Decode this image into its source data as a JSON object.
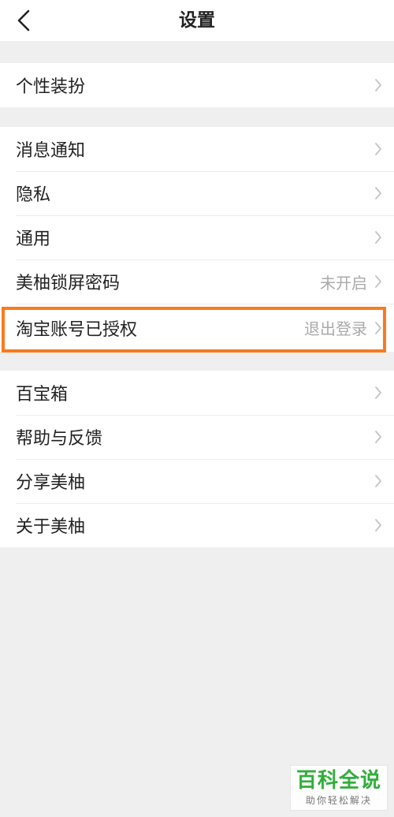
{
  "header": {
    "title": "设置"
  },
  "groups": [
    {
      "items": [
        {
          "label": "个性装扮",
          "value": ""
        }
      ]
    },
    {
      "items": [
        {
          "label": "消息通知",
          "value": ""
        },
        {
          "label": "隐私",
          "value": ""
        },
        {
          "label": "通用",
          "value": ""
        },
        {
          "label": "美柚锁屏密码",
          "value": "未开启"
        },
        {
          "label": "淘宝账号已授权",
          "value": "退出登录"
        }
      ]
    },
    {
      "items": [
        {
          "label": "百宝箱",
          "value": ""
        },
        {
          "label": "帮助与反馈",
          "value": ""
        },
        {
          "label": "分享美柚",
          "value": ""
        },
        {
          "label": "关于美柚",
          "value": ""
        }
      ]
    }
  ],
  "watermark": {
    "main": "百科全说",
    "sub": "助你轻松解决"
  },
  "icons": {
    "back": "chevron-left-icon",
    "row": "chevron-right-icon"
  },
  "colors": {
    "highlight": "#f77b1e",
    "watermark_green": "#2fae3a",
    "background": "#efefef"
  }
}
